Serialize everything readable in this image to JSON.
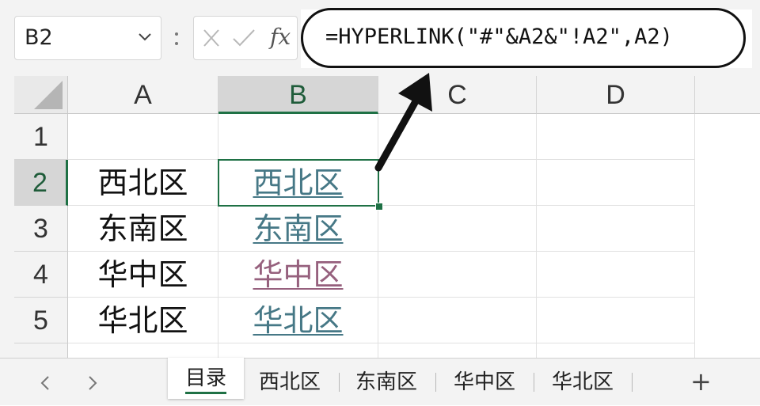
{
  "formula_bar": {
    "name_box": "B2",
    "fx_label": "fx",
    "formula": "=HYPERLINK(\"#\"&A2&\"!A2\",A2)"
  },
  "grid": {
    "columns": [
      "A",
      "B",
      "C",
      "D"
    ],
    "rows": [
      "1",
      "2",
      "3",
      "4",
      "5"
    ],
    "selected_cell": "B2",
    "cells": {
      "A2": "西北区",
      "A3": "东南区",
      "A4": "华中区",
      "A5": "华北区",
      "B2": "西北区",
      "B3": "东南区",
      "B4": "华中区",
      "B5": "华北区"
    }
  },
  "sheet_tabs": {
    "tabs": [
      "目录",
      "西北区",
      "东南区",
      "华中区",
      "华北区"
    ],
    "active": "目录",
    "add_label": "+"
  },
  "colors": {
    "accent_green": "#1f7145",
    "link": "#467886",
    "visited_link": "#96607d"
  },
  "icons": {
    "dropdown": "chevron-down-icon",
    "cancel": "cancel-x-icon",
    "enter": "checkmark-icon",
    "prev": "chevron-left-icon",
    "next": "chevron-right-icon"
  }
}
